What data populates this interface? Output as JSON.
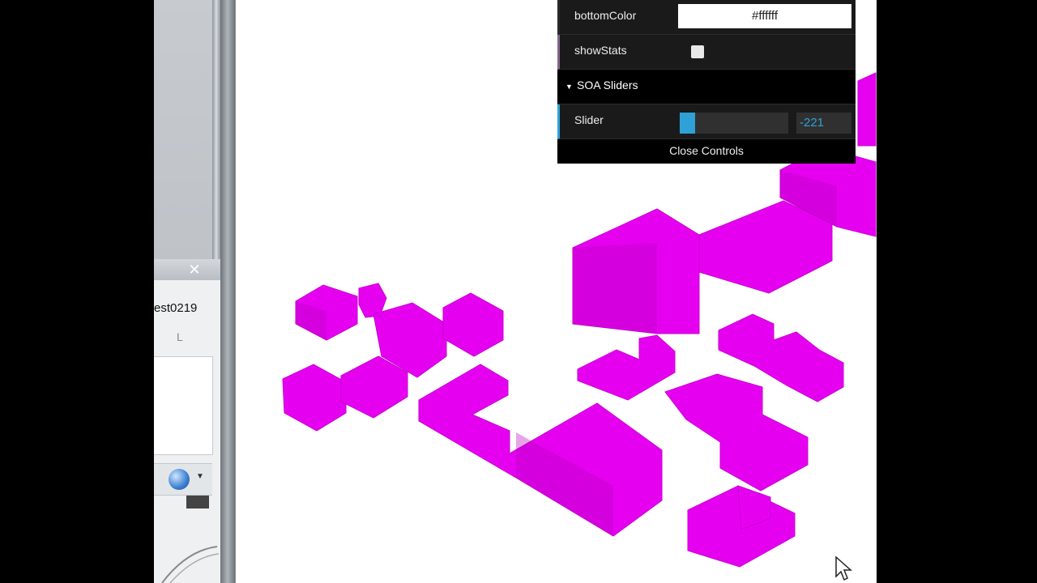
{
  "left_panel": {
    "title": "est0219",
    "column_label": "L",
    "close_glyph": "✕"
  },
  "gui": {
    "bottom_color_label": "bottomColor",
    "bottom_color_value": "#ffffff",
    "show_stats_label": "showStats",
    "show_stats_checked": false,
    "folder_title": "SOA Sliders",
    "slider_label": "Slider",
    "slider_value": "-221",
    "slider_fill_fraction": 0.14,
    "close_label": "Close Controls",
    "accent_color": "#2fa1d6"
  },
  "scene": {
    "building_color": "#e600f0",
    "icons": [
      "sphere-icon",
      "close-icon",
      "mouse-cursor-icon"
    ]
  }
}
